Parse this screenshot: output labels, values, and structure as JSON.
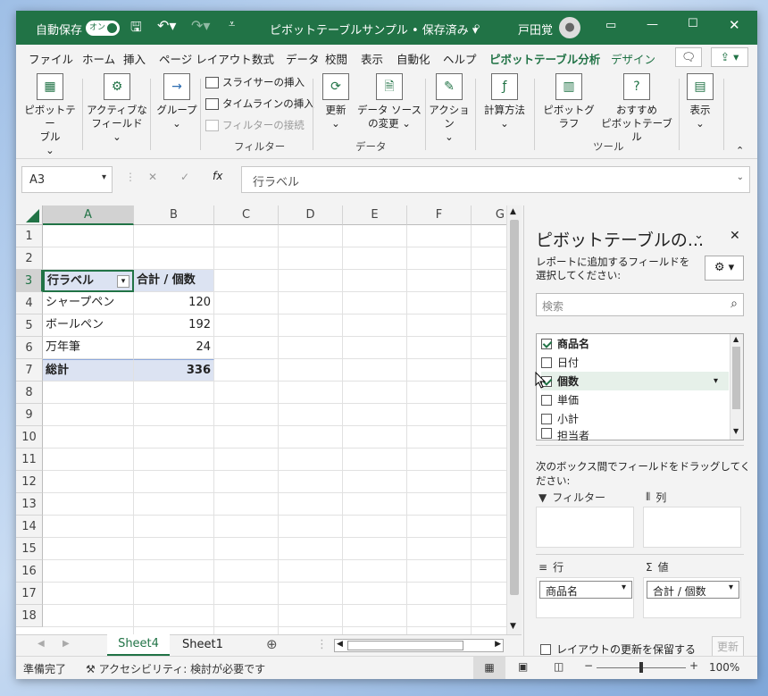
{
  "titlebar": {
    "autosave_label": "自動保存",
    "autosave_state": "オン",
    "title": "ピボットテーブルサンプル • 保存済み",
    "user": "戸田覚"
  },
  "tabs": [
    "ファイル",
    "ホーム",
    "挿入",
    "ページ レイアウト",
    "数式",
    "データ",
    "校閲",
    "表示",
    "自動化",
    "ヘルプ",
    "ピボットテーブル分析",
    "デザイン"
  ],
  "ribbon": {
    "pivot_table": "ピボットテー\nブル",
    "active_field": "アクティブな\nフィールド",
    "group": "グループ",
    "slicer": "スライサーの挿入",
    "timeline": "タイムラインの挿入",
    "filter_conn": "フィルターの接続",
    "group_filter": "フィルター",
    "refresh": "更新",
    "change_source": "データ ソース\nの変更",
    "group_data": "データ",
    "actions": "アクション",
    "calculations": "計算方法",
    "pivot_chart": "ピボットグラフ",
    "recommended": "おすすめ\nピボットテーブル",
    "group_tools": "ツール",
    "show": "表示"
  },
  "formula_bar": {
    "name_box": "A3",
    "formula": "行ラベル"
  },
  "grid": {
    "columns": [
      "A",
      "B",
      "C",
      "D",
      "E",
      "F",
      "G"
    ],
    "rows": [
      "1",
      "2",
      "3",
      "4",
      "5",
      "6",
      "7",
      "8",
      "9",
      "10",
      "11",
      "12",
      "13",
      "14",
      "15",
      "16",
      "17",
      "18"
    ],
    "pivot_header": [
      "行ラベル",
      "合計 / 個数"
    ],
    "pivot_rows": [
      {
        "label": "シャープペン",
        "value": "120"
      },
      {
        "label": "ボールペン",
        "value": "192"
      },
      {
        "label": "万年筆",
        "value": "24"
      }
    ],
    "total": {
      "label": "総計",
      "value": "336"
    }
  },
  "sheets": [
    "Sheet4",
    "Sheet1"
  ],
  "status": {
    "ready": "準備完了",
    "accessibility": "アクセシビリティ: 検討が必要です",
    "zoom": "100%"
  },
  "pane": {
    "title": "ピボットテーブルの...",
    "instruction": "レポートに追加するフィールドを選択してください:",
    "search_placeholder": "検索",
    "fields": [
      {
        "name": "商品名",
        "checked": true
      },
      {
        "name": "日付",
        "checked": false
      },
      {
        "name": "個数",
        "checked": true
      },
      {
        "name": "単価",
        "checked": false
      },
      {
        "name": "小計",
        "checked": false
      },
      {
        "name": "担当者",
        "checked": false
      }
    ],
    "drag_hint": "次のボックス間でフィールドをドラッグしてください:",
    "zone_filter": "フィルター",
    "zone_columns": "列",
    "zone_rows": "行",
    "zone_values": "値",
    "rows_chip": "商品名",
    "values_chip": "合計 / 個数",
    "defer_label": "レイアウトの更新を保留する",
    "update_button": "更新"
  }
}
